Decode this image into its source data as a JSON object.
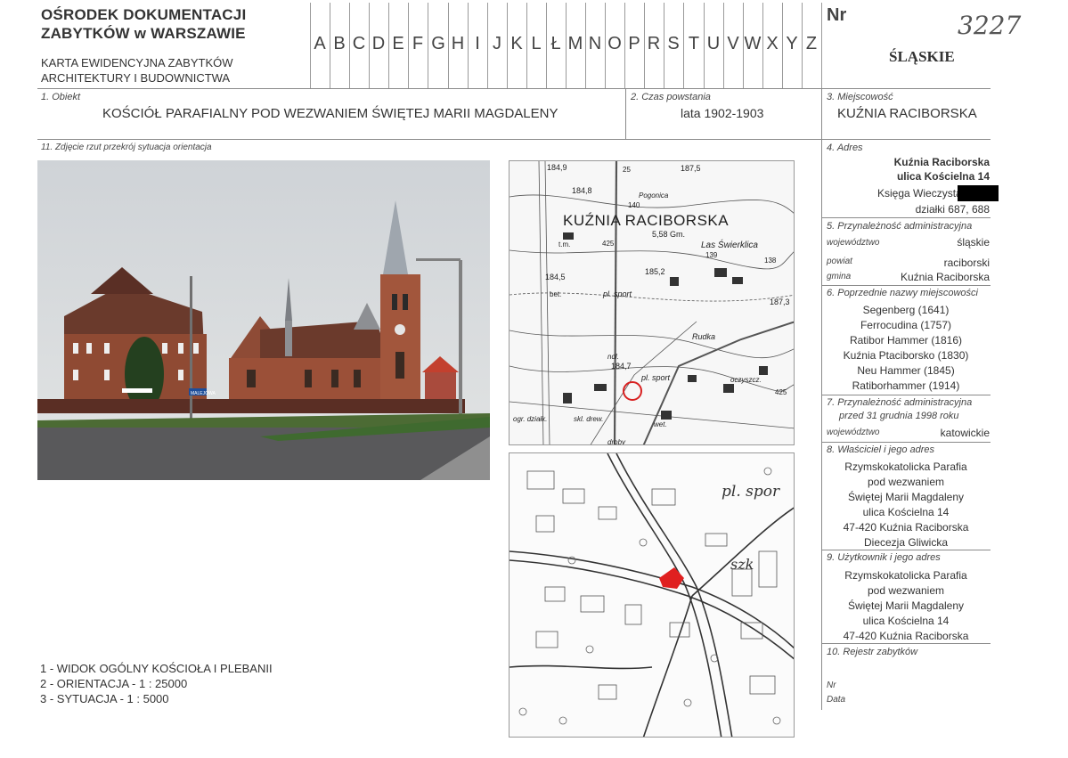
{
  "header": {
    "institution_line1": "OŚRODEK DOKUMENTACJI",
    "institution_line2": "ZABYTKÓW w WARSZAWIE",
    "card_line1": "KARTA EWIDENCYJNA ZABYTKÓW",
    "card_line2": "ARCHITEKTURY I BUDOWNICTWA",
    "letters": [
      "A",
      "B",
      "C",
      "D",
      "E",
      "F",
      "G",
      "H",
      "I",
      "J",
      "K",
      "L",
      "Ł",
      "M",
      "N",
      "O",
      "P",
      "R",
      "S",
      "T",
      "U",
      "V",
      "W",
      "X",
      "Y",
      "Z"
    ],
    "nr_label": "Nr",
    "nr_handwritten": "3227",
    "voivodeship": "ŚLĄSKIE"
  },
  "field1": {
    "label": "1.  Obiekt",
    "value": "KOŚCIÓŁ PARAFIALNY POD WEZWANIEM ŚWIĘTEJ MARII MAGDALENY"
  },
  "field2": {
    "label": "2.  Czas powstania",
    "value": "lata 1902-1903"
  },
  "field3": {
    "label": "3.  Miejscowość",
    "value": "KUŹNIA RACIBORSKA"
  },
  "field11": {
    "label": "11.  Zdjęcie rzut przekrój sytuacja orientacja"
  },
  "field4": {
    "label": "4.  Adres",
    "line1": "Kuźnia Raciborska",
    "line2": "ulica Kościelna 14",
    "line3": "Księga Wieczysta",
    "line4": "działki  687, 688"
  },
  "field5": {
    "label": "5.  Przynależność administracyjna",
    "wojewodztwo_label": "województwo",
    "wojewodztwo_value": "śląskie",
    "powiat_label": "powiat",
    "powiat_value": "raciborski",
    "gmina_label": "gmina",
    "gmina_value": "Kuźnia Raciborska"
  },
  "field6": {
    "label": "6.  Poprzednie nazwy miejscowości",
    "names": [
      "Segenberg (1641)",
      "Ferrocudina (1757)",
      "Ratibor Hammer (1816)",
      "Kuźnia Ptaciborsko (1830)",
      "Neu Hammer (1845)",
      "Ratiborhammer (1914)"
    ]
  },
  "field7": {
    "label": "7.  Przynależność administracyjna",
    "sublabel": "przed 31 grudnia 1998 roku",
    "wojewodztwo_label": "województwo",
    "wojewodztwo_value": "katowickie"
  },
  "field8": {
    "label": "8.  Właściciel i jego adres",
    "lines": [
      "Rzymskokatolicka  Parafia",
      "pod wezwaniem",
      "Świętej Marii Magdaleny",
      "ulica Kościelna 14",
      "47-420 Kuźnia Raciborska",
      "Diecezja Gliwicka"
    ]
  },
  "field9": {
    "label": "9.  Użytkownik  i jego adres",
    "lines": [
      "Rzymskokatolicka  Parafia",
      "pod wezwaniem",
      "Świętej Marii Magdaleny",
      "ulica Kościelna 14",
      "47-420 Kuźnia Raciborska"
    ]
  },
  "field10": {
    "label": "10.  Rejestr zabytków",
    "nr_label": "Nr",
    "data_label": "Data"
  },
  "legend": {
    "line1": "1 - WIDOK OGÓLNY KOŚCIOŁA I PLEBANII",
    "line2": "2 - ORIENTACJA  -  1 :  25000",
    "line3": "3 - SYTUACJA  -  1 : 5000"
  },
  "map1": {
    "town": "KUŹNIA RACIBORSKA",
    "labels": [
      "184,9",
      "25",
      "187,5",
      "184,8",
      "Pogonica",
      "140",
      "5,58 Gm.",
      "Las Świerklica",
      "139",
      "138",
      "t.m.",
      "425",
      "185,2",
      "184,5",
      "bet.",
      "pl. sport",
      "187,3",
      "Rudka",
      "ndl.",
      "184,7",
      "pl. sport",
      "oczyszcz.",
      "425",
      "ogr. działk.",
      "skl. drew.",
      "wet.",
      "droby"
    ]
  },
  "map2": {
    "labels": [
      "pl. spor",
      "szk"
    ]
  },
  "photo": {
    "signs": [
      "MALEJOWA"
    ]
  },
  "colors": {
    "line": "#8a8a8a",
    "site_marker": "#e02020"
  }
}
